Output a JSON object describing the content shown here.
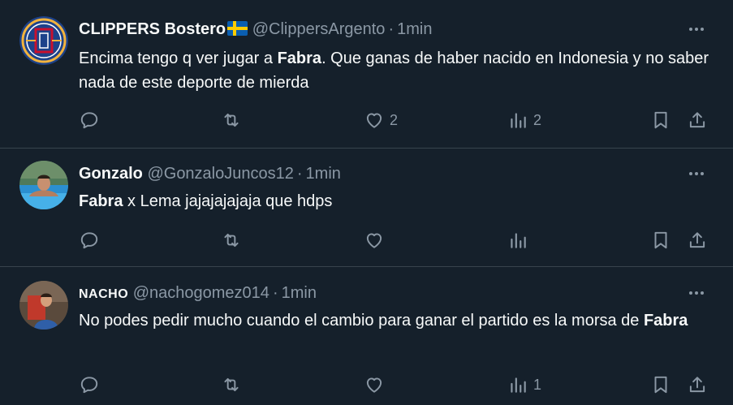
{
  "tweets": [
    {
      "display_name": "CLIPPERS Bostero",
      "handle": "@ClippersArgento",
      "separator": "·",
      "time": "1min",
      "text_parts": [
        "Encima tengo q ver jugar a ",
        "Fabra",
        ". Que ganas de haber nacido en Indonesia y no saber nada de este deporte de mierda"
      ],
      "likes": "2",
      "views": "2",
      "replies": "",
      "retweets": ""
    },
    {
      "display_name": "Gonzalo",
      "handle": "@GonzaloJuncos12",
      "separator": "·",
      "time": "1min",
      "text_parts": [
        "Fabra",
        " x Lema jajajajajaja que hdps",
        ""
      ],
      "likes": "",
      "views": "",
      "replies": "",
      "retweets": ""
    },
    {
      "display_name": "NACHO",
      "handle": "@nachogomez014",
      "separator": "·",
      "time": "1min",
      "text_parts": [
        "No podes pedir mucho cuando el cambio para ganar el partido es la morsa de ",
        "Fabra",
        ""
      ],
      "likes": "",
      "views": "1",
      "replies": "",
      "retweets": ""
    }
  ],
  "colors": {
    "background": "#15202b",
    "text": "#f7f9f9",
    "secondary": "#8b98a5",
    "divider": "#38444d",
    "flag_blue": "#0a5eb0",
    "flag_yellow": "#fecc00"
  },
  "icons": [
    "reply-icon",
    "retweet-icon",
    "like-icon",
    "views-icon",
    "bookmark-icon",
    "share-icon",
    "more-icon",
    "sweden-flag-icon"
  ]
}
